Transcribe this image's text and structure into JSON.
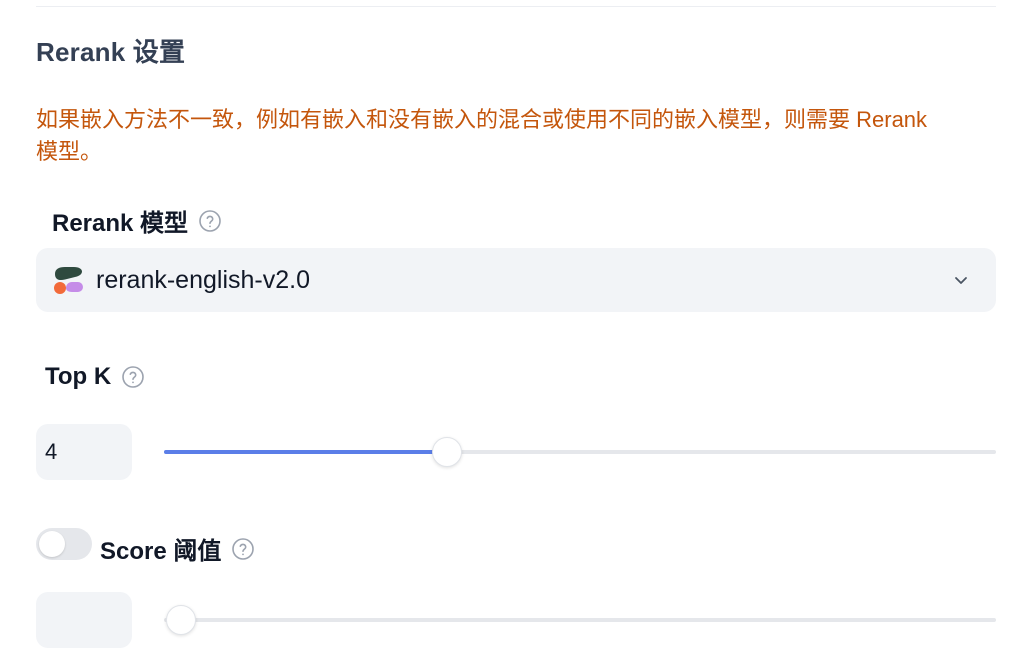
{
  "section": {
    "title": "Rerank 设置",
    "warning": "如果嵌入方法不一致，例如有嵌入和没有嵌入的混合或使用不同的嵌入模型，则需要 Rerank 模型。"
  },
  "rerank_model": {
    "label": "Rerank 模型",
    "selected": "rerank-english-v2.0",
    "provider_icon": "cohere-logo-icon"
  },
  "top_k": {
    "label": "Top K",
    "value": "4",
    "slider_fraction": 0.34
  },
  "score_threshold": {
    "label": "Score 阈值",
    "enabled": false,
    "value": "",
    "slider_fraction": 0.02
  },
  "colors": {
    "accent": "#5b7ee8",
    "warning": "#c4560c",
    "input_bg": "#f2f4f7"
  }
}
